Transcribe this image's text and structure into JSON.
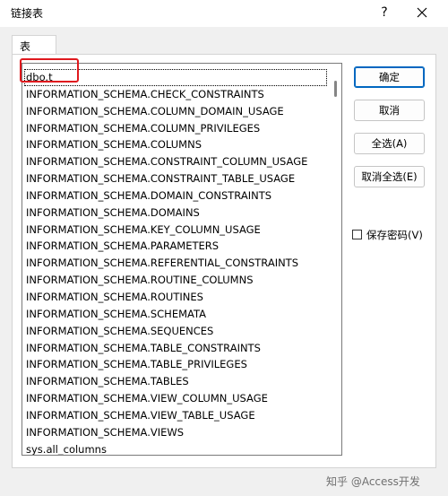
{
  "window": {
    "title": "链接表",
    "help_label": "?"
  },
  "tab": {
    "label": "表"
  },
  "tables": [
    "dbo.t",
    "INFORMATION_SCHEMA.CHECK_CONSTRAINTS",
    "INFORMATION_SCHEMA.COLUMN_DOMAIN_USAGE",
    "INFORMATION_SCHEMA.COLUMN_PRIVILEGES",
    "INFORMATION_SCHEMA.COLUMNS",
    "INFORMATION_SCHEMA.CONSTRAINT_COLUMN_USAGE",
    "INFORMATION_SCHEMA.CONSTRAINT_TABLE_USAGE",
    "INFORMATION_SCHEMA.DOMAIN_CONSTRAINTS",
    "INFORMATION_SCHEMA.DOMAINS",
    "INFORMATION_SCHEMA.KEY_COLUMN_USAGE",
    "INFORMATION_SCHEMA.PARAMETERS",
    "INFORMATION_SCHEMA.REFERENTIAL_CONSTRAINTS",
    "INFORMATION_SCHEMA.ROUTINE_COLUMNS",
    "INFORMATION_SCHEMA.ROUTINES",
    "INFORMATION_SCHEMA.SCHEMATA",
    "INFORMATION_SCHEMA.SEQUENCES",
    "INFORMATION_SCHEMA.TABLE_CONSTRAINTS",
    "INFORMATION_SCHEMA.TABLE_PRIVILEGES",
    "INFORMATION_SCHEMA.TABLES",
    "INFORMATION_SCHEMA.VIEW_COLUMN_USAGE",
    "INFORMATION_SCHEMA.VIEW_TABLE_USAGE",
    "INFORMATION_SCHEMA.VIEWS",
    "sys.all_columns"
  ],
  "buttons": {
    "ok": "确定",
    "cancel": "取消",
    "select_all": "全选(A)",
    "deselect_all": "取消全选(E)"
  },
  "save_password": {
    "label": "保存密码(V)",
    "checked": false
  },
  "watermark": "知乎 @Access开发",
  "colors": {
    "highlight_box": "#e0191e",
    "primary_border": "#0067c0"
  }
}
